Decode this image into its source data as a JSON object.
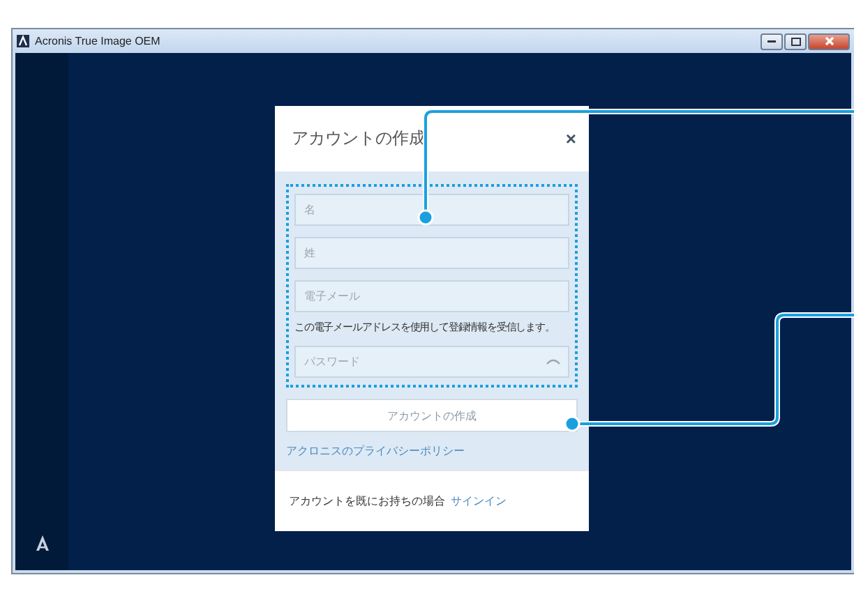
{
  "window": {
    "title": "Acronis True Image OEM"
  },
  "dialog": {
    "title": "アカウントの作成",
    "close": "×",
    "fields": [
      {
        "placeholder": "名",
        "kind": "text"
      },
      {
        "placeholder": "姓",
        "kind": "text"
      },
      {
        "placeholder": "電子メール",
        "kind": "text",
        "hint": "この電子メールアドレスを使用して登録情報を受信します。"
      },
      {
        "placeholder": "パスワード",
        "kind": "password"
      }
    ],
    "submit": {
      "label": "アカウントの作成",
      "disabled": true
    },
    "privacy_link": "アクロニスのプライバシーポリシー",
    "footer": {
      "text": "アカウントを既にお持ちの場合",
      "link": "サインイン"
    }
  }
}
